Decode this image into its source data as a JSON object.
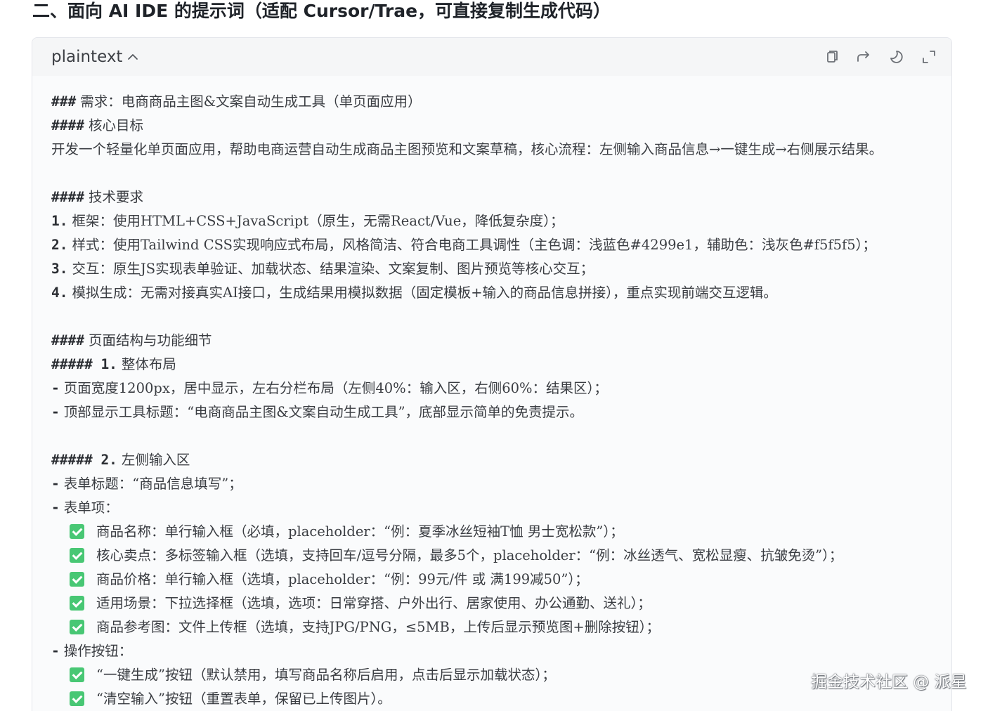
{
  "heading": "二、面向 AI IDE 的提示词（适配 Cursor/Trae，可直接复制生成代码）",
  "code_block": {
    "language": "plaintext",
    "toolbar": {
      "copy_icon": "copy-icon",
      "share_icon": "share-icon",
      "theme_icon": "moon-icon",
      "expand_icon": "expand-icon"
    },
    "lines": [
      {
        "md": "###",
        "text": "需求：电商商品主图&文案自动生成工具（单页面应用）"
      },
      {
        "md": "####",
        "text": "核心目标"
      },
      {
        "md": "",
        "text": "开发一个轻量化单页面应用，帮助电商运营自动生成商品主图预览和文案草稿，核心流程：左侧输入商品信息→一键生成→右侧展示结果。"
      },
      {
        "md": "",
        "text": ""
      },
      {
        "md": "####",
        "text": "技术要求"
      },
      {
        "md": "1.",
        "text": "框架：使用HTML+CSS+JavaScript（原生，无需React/Vue，降低复杂度）；"
      },
      {
        "md": "2.",
        "text": "样式：使用Tailwind CSS实现响应式布局，风格简洁、符合电商工具调性（主色调：浅蓝色#4299e1，辅助色：浅灰色#f5f5f5）；"
      },
      {
        "md": "3.",
        "text": "交互：原生JS实现表单验证、加载状态、结果渲染、文案复制、图片预览等核心交互；"
      },
      {
        "md": "4.",
        "text": "模拟生成：无需对接真实AI接口，生成结果用模拟数据（固定模板+输入的商品信息拼接），重点实现前端交互逻辑。"
      },
      {
        "md": "",
        "text": ""
      },
      {
        "md": "####",
        "text": "页面结构与功能细节"
      },
      {
        "md": "##### 1.",
        "text": "整体布局"
      },
      {
        "md": "-",
        "text": "页面宽度1200px，居中显示，左右分栏布局（左侧40%：输入区，右侧60%：结果区）；"
      },
      {
        "md": "-",
        "text": "顶部显示工具标题：“电商商品主图&文案自动生成工具”，底部显示简单的免责提示。"
      },
      {
        "md": "",
        "text": ""
      },
      {
        "md": "##### 2.",
        "text": "左侧输入区"
      },
      {
        "md": "-",
        "text": "表单标题：“商品信息填写”；"
      },
      {
        "md": "-",
        "text": "表单项："
      }
    ],
    "checklist_1": [
      "商品名称：单行输入框（必填，placeholder：“例：夏季冰丝短袖T恤 男士宽松款”）；",
      "核心卖点：多标签输入框（选填，支持回车/逗号分隔，最多5个，placeholder：“例：冰丝透气、宽松显瘦、抗皱免烫”）；",
      "商品价格：单行输入框（选填，placeholder：“例：99元/件 或 满199减50”）；",
      "适用场景：下拉选择框（选填，选项：日常穿搭、户外出行、居家使用、办公通勤、送礼）；",
      "商品参考图：文件上传框（选填，支持JPG/PNG，≤5MB，上传后显示预览图+删除按钮）；"
    ],
    "after_checklist_line": {
      "md": "-",
      "text": "操作按钮："
    },
    "checklist_2": [
      "“一键生成”按钮（默认禁用，填写商品名称后启用，点击后显示加载状态）；",
      "“清空输入”按钮（重置表单，保留已上传图片）。"
    ]
  },
  "watermark": "掘金技术社区 @ 派星",
  "colors": {
    "check_green": "#48c774",
    "header_bg": "#f5f6f7",
    "block_bg": "#fafbfc",
    "border": "#e4e6eb"
  }
}
